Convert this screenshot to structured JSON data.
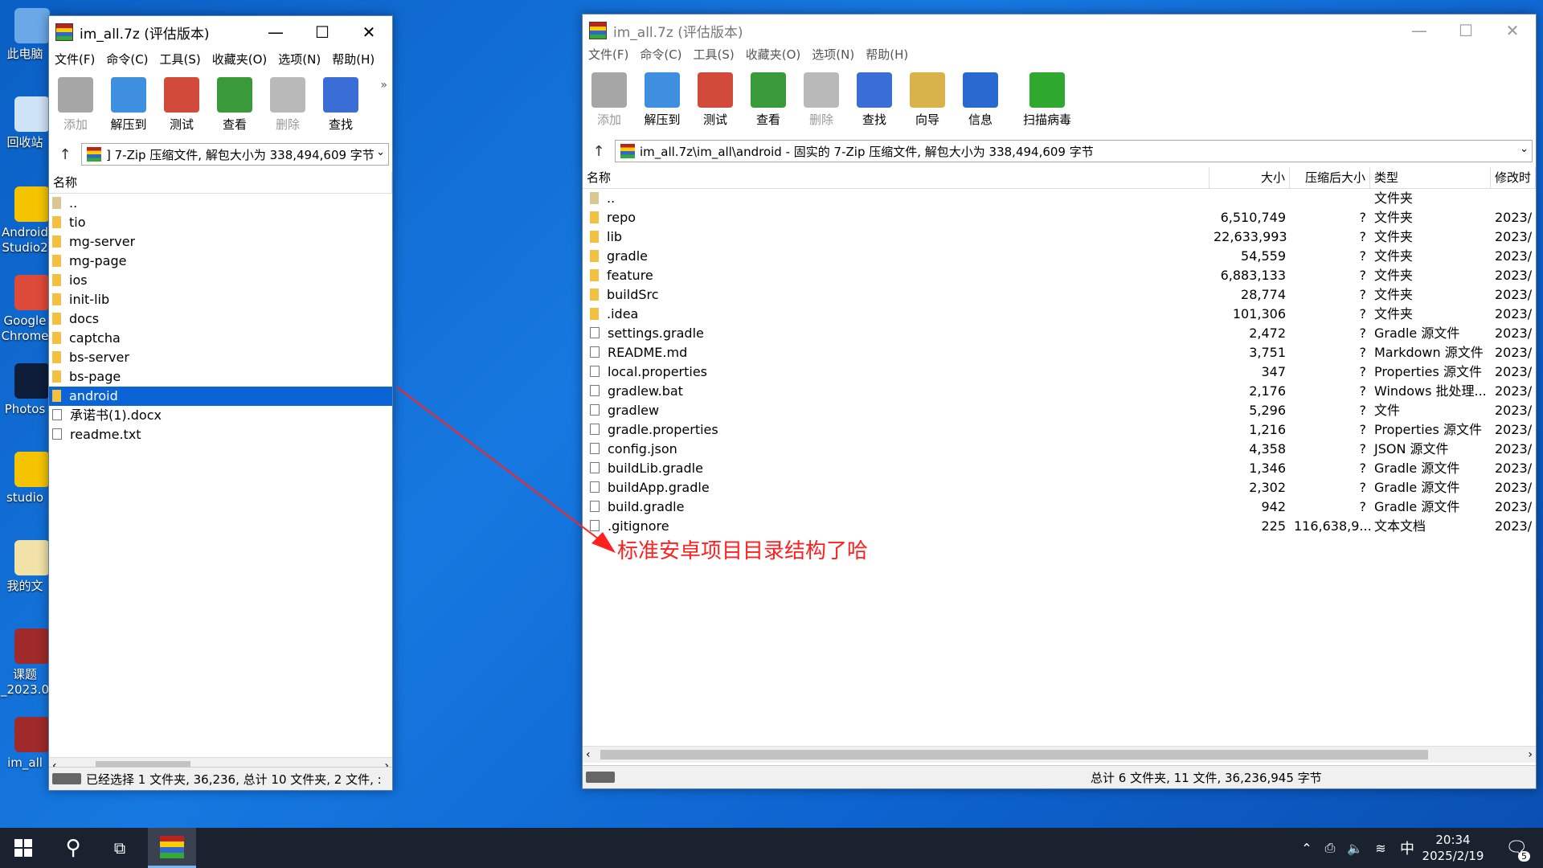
{
  "desktop": {
    "icons": [
      {
        "label": "此电脑",
        "color": "#6aa8e8"
      },
      {
        "label": "回收站",
        "color": "#cfe3f7"
      },
      {
        "label": "Android Studio2",
        "color": "#f5c400"
      },
      {
        "label": "Google Chrome",
        "color": "#de4a3a"
      },
      {
        "label": "Photos",
        "color": "#0d1d3a"
      },
      {
        "label": "studio",
        "color": "#f5c400"
      },
      {
        "label": "我的文",
        "color": "#f3e2a8"
      },
      {
        "label": "课题 _2023.0",
        "color": "#a02a2a"
      },
      {
        "label": "im_all",
        "color": "#a02a2a"
      }
    ]
  },
  "left_window": {
    "title": "im_all.7z (评估版本)",
    "menu": [
      "文件(F)",
      "命令(C)",
      "工具(S)",
      "收藏夹(O)",
      "选项(N)",
      "帮助(H)"
    ],
    "toolbar": [
      {
        "label": "添加",
        "icon": "add-icon",
        "color": "#6a6a6a",
        "disabled": true
      },
      {
        "label": "解压到",
        "icon": "extract-icon",
        "color": "#3f8fe0"
      },
      {
        "label": "测试",
        "icon": "test-icon",
        "color": "#d24a3a"
      },
      {
        "label": "查看",
        "icon": "view-icon",
        "color": "#3a9a3a"
      },
      {
        "label": "删除",
        "icon": "delete-icon",
        "color": "#8a8a8a",
        "disabled": true
      },
      {
        "label": "查找",
        "icon": "find-icon",
        "color": "#3a6ed6"
      }
    ],
    "more": "»",
    "address": "] 7-Zip 压缩文件, 解包大小为 338,494,609 字节",
    "column_name": "名称",
    "rows": [
      {
        "name": "..",
        "type": "up"
      },
      {
        "name": "tio",
        "type": "folder"
      },
      {
        "name": "mg-server",
        "type": "folder"
      },
      {
        "name": "mg-page",
        "type": "folder"
      },
      {
        "name": "ios",
        "type": "folder"
      },
      {
        "name": "init-lib",
        "type": "folder"
      },
      {
        "name": "docs",
        "type": "folder"
      },
      {
        "name": "captcha",
        "type": "folder"
      },
      {
        "name": "bs-server",
        "type": "folder"
      },
      {
        "name": "bs-page",
        "type": "folder"
      },
      {
        "name": "android",
        "type": "folder",
        "selected": true
      },
      {
        "name": "承诺书(1).docx",
        "type": "file"
      },
      {
        "name": "readme.txt",
        "type": "file"
      }
    ],
    "status": "已经选择 1 文件夹, 36,236, 总计 10 文件夹, 2 文件, :"
  },
  "right_window": {
    "title": "im_all.7z (评估版本)",
    "menu": [
      "文件(F)",
      "命令(C)",
      "工具(S)",
      "收藏夹(O)",
      "选项(N)",
      "帮助(H)"
    ],
    "toolbar": [
      {
        "label": "添加",
        "icon": "add-icon",
        "color": "#6a6a6a",
        "disabled": true
      },
      {
        "label": "解压到",
        "icon": "extract-icon",
        "color": "#3f8fe0"
      },
      {
        "label": "测试",
        "icon": "test-icon",
        "color": "#d24a3a"
      },
      {
        "label": "查看",
        "icon": "view-icon",
        "color": "#3a9a3a"
      },
      {
        "label": "删除",
        "icon": "delete-icon",
        "color": "#8a8a8a",
        "disabled": true
      },
      {
        "label": "查找",
        "icon": "find-icon",
        "color": "#3a6ed6"
      },
      {
        "label": "向导",
        "icon": "wizard-icon",
        "color": "#d8b24a"
      },
      {
        "label": "信息",
        "icon": "info-icon",
        "color": "#2a6ad0"
      },
      {
        "label": "扫描病毒",
        "icon": "virus-scan-icon",
        "color": "#2fa82f"
      }
    ],
    "address": "im_all.7z\\im_all\\android - 固实的 7-Zip 压缩文件, 解包大小为 338,494,609 字节",
    "columns": [
      "名称",
      "大小",
      "压缩后大小",
      "类型",
      "修改时"
    ],
    "rows": [
      {
        "name": "..",
        "size": "",
        "packed": "",
        "type": "文件夹",
        "mod": "",
        "kind": "up"
      },
      {
        "name": "repo",
        "size": "6,510,749",
        "packed": "?",
        "type": "文件夹",
        "mod": "2023/",
        "kind": "folder"
      },
      {
        "name": "lib",
        "size": "22,633,993",
        "packed": "?",
        "type": "文件夹",
        "mod": "2023/",
        "kind": "folder"
      },
      {
        "name": "gradle",
        "size": "54,559",
        "packed": "?",
        "type": "文件夹",
        "mod": "2023/",
        "kind": "folder"
      },
      {
        "name": "feature",
        "size": "6,883,133",
        "packed": "?",
        "type": "文件夹",
        "mod": "2023/",
        "kind": "folder"
      },
      {
        "name": "buildSrc",
        "size": "28,774",
        "packed": "?",
        "type": "文件夹",
        "mod": "2023/",
        "kind": "folder"
      },
      {
        "name": ".idea",
        "size": "101,306",
        "packed": "?",
        "type": "文件夹",
        "mod": "2023/",
        "kind": "folder"
      },
      {
        "name": "settings.gradle",
        "size": "2,472",
        "packed": "?",
        "type": "Gradle 源文件",
        "mod": "2023/",
        "kind": "file"
      },
      {
        "name": "README.md",
        "size": "3,751",
        "packed": "?",
        "type": "Markdown 源文件",
        "mod": "2023/",
        "kind": "file"
      },
      {
        "name": "local.properties",
        "size": "347",
        "packed": "?",
        "type": "Properties 源文件",
        "mod": "2023/",
        "kind": "file"
      },
      {
        "name": "gradlew.bat",
        "size": "2,176",
        "packed": "?",
        "type": "Windows 批处理...",
        "mod": "2023/",
        "kind": "file"
      },
      {
        "name": "gradlew",
        "size": "5,296",
        "packed": "?",
        "type": "文件",
        "mod": "2023/",
        "kind": "file"
      },
      {
        "name": "gradle.properties",
        "size": "1,216",
        "packed": "?",
        "type": "Properties 源文件",
        "mod": "2023/",
        "kind": "file"
      },
      {
        "name": "config.json",
        "size": "4,358",
        "packed": "?",
        "type": "JSON 源文件",
        "mod": "2023/",
        "kind": "file"
      },
      {
        "name": "buildLib.gradle",
        "size": "1,346",
        "packed": "?",
        "type": "Gradle 源文件",
        "mod": "2023/",
        "kind": "file"
      },
      {
        "name": "buildApp.gradle",
        "size": "2,302",
        "packed": "?",
        "type": "Gradle 源文件",
        "mod": "2023/",
        "kind": "file"
      },
      {
        "name": "build.gradle",
        "size": "942",
        "packed": "?",
        "type": "Gradle 源文件",
        "mod": "2023/",
        "kind": "file"
      },
      {
        "name": ".gitignore",
        "size": "225",
        "packed": "116,638,9...",
        "type": "文本文档",
        "mod": "2023/",
        "kind": "file"
      }
    ],
    "status": "总计 6 文件夹, 11 文件, 36,236,945 字节"
  },
  "annotation": "标准安卓项目目录结构了哈",
  "taskbar": {
    "time": "20:34",
    "date": "2025/2/19",
    "ime": "中",
    "notifications": "5"
  }
}
